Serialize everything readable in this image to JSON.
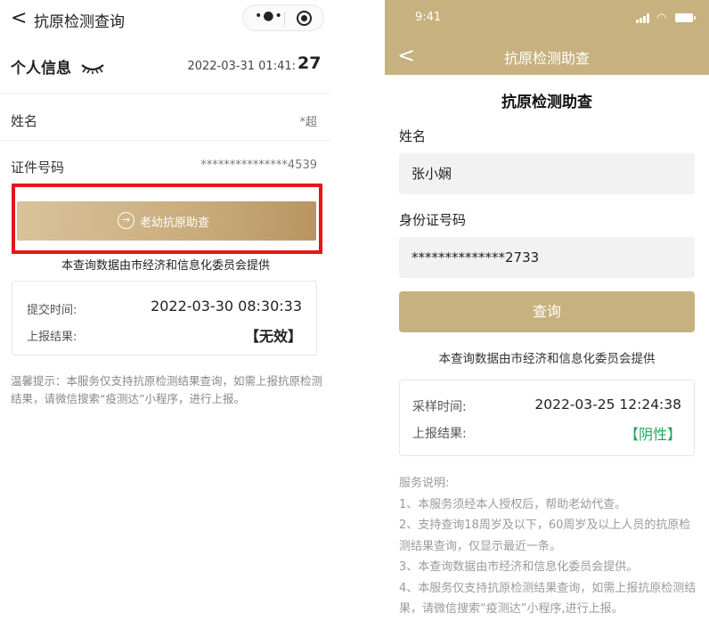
{
  "left": {
    "nav": {
      "back_glyph": "<",
      "title": "抗原检测查询",
      "menu_icon": "more-dots-icon",
      "close_icon": "target-close-icon"
    },
    "info": {
      "title": "个人信息",
      "eye_icon": "closed-eye-icon",
      "datetime": "2022-03-31 01:41:",
      "seconds": "27"
    },
    "rows": [
      {
        "label": "姓名",
        "value": "*超"
      },
      {
        "label": "证件号码",
        "value": "***************4539"
      }
    ],
    "button": {
      "label": "老幼抗原助查",
      "icon": "enter-circle-icon",
      "highlight_color": "#e5161b"
    },
    "provider": "本查询数据由市经济和信息化委员会提供",
    "card": [
      {
        "label": "提交时间:",
        "value": "2022-03-30 08:30:33"
      },
      {
        "label": "上报结果:",
        "value": "【无效】"
      }
    ],
    "hint": "温馨提示：本服务仅支持抗原检测结果查询，如需上报抗原检测结果，请微信搜索“疫测达”小程序，进行上报。"
  },
  "right": {
    "status_bar": {
      "time": "9:41",
      "signal_icon": "signal-icon",
      "wifi_icon": "wifi-icon",
      "battery_icon": "battery-icon"
    },
    "nav": {
      "back_glyph": "<",
      "title": "抗原检测助查"
    },
    "heading": "抗原检测助查",
    "name_label": "姓名",
    "name_value": "张小娴",
    "id_label": "身份证号码",
    "id_value": "**************2733",
    "button_label": "查询",
    "provider": "本查询数据由市经济和信息化委员会提供",
    "card": [
      {
        "label": "采样时间:",
        "value": "2022-03-25 12:24:38"
      },
      {
        "label": "上报结果:",
        "value": "【阴性】"
      }
    ],
    "notes": [
      "服务说明:",
      "1、本服务须经本人授权后，帮助老幼代查。",
      "2、支持查询18周岁及以下，60周岁及以上人员的抗原检测结果查询，仅显示最近一条。",
      "3、本查询数据由市经济和信息化委员会提供。",
      "4、本服务仅支持抗原检测结果查询，如需上报抗原检测结果，请微信搜索“疫测达”小程序,进行上报。"
    ]
  },
  "colors": {
    "gold": "#c6b17f",
    "result_green": "#21a65a",
    "highlight_red": "#e5161b"
  }
}
